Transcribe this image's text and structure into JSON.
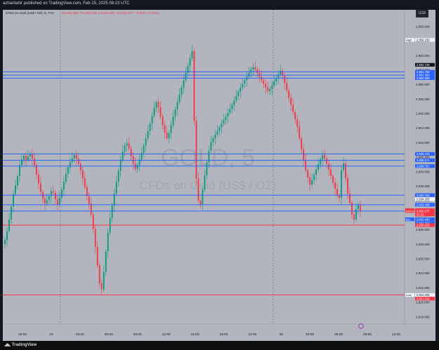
{
  "header": {
    "published": "azhantahir published on TradingView.com, Feb 25, 2025 08:23 UTC"
  },
  "legend": {
    "symbol": "CFDs on Gold (US$ / OZ), 5, TVC",
    "o": "O2,932.686",
    "h": "H2,933.868",
    "l": "L2,932.035",
    "c": "C2,932.577",
    "change": "−0.003 (−0.00%)"
  },
  "watermark": {
    "line1": "GOLD, 5",
    "line2": "CFDs on Gold (US$ / OZ)"
  },
  "currency_button": "USD",
  "footer": {
    "brand": "TradingView"
  },
  "colors": {
    "background": "#b2b5be",
    "up_candle": "#089981",
    "down_candle": "#f23645",
    "blue_line": "#2962ff",
    "red_line": "#f23645"
  },
  "chart_data": {
    "type": "candlestick",
    "title": "CFDs on Gold (US$ / OZ), 5, TVC",
    "ylim": [
      2917.0,
      2960.3
    ],
    "y_ticks": [
      2958,
      2956,
      2954,
      2952,
      2950,
      2948,
      2946,
      2944,
      2942,
      2940,
      2938,
      2936,
      2934,
      2932,
      2930,
      2928,
      2926,
      2924,
      2922,
      2920,
      2918
    ],
    "y_tick_labels": [
      "2,958.000",
      "2,956.000",
      "2,954.000",
      "2,952.000",
      "2,950.000",
      "2,948.000",
      "2,946.000",
      "2,944.000",
      "2,942.000",
      "2,940.000",
      "2,938.000",
      "2,936.000",
      "2,934.000",
      "2,932.000",
      "2,930.000",
      "2,928.000",
      "2,926.000",
      "2,924.000",
      "2,922.000",
      "2,920.000",
      "2,918.000"
    ],
    "x_ticks": [
      "18:00",
      "23",
      "03:00",
      "06:00",
      "09:00",
      "12:00",
      "15:00",
      "18:00",
      "21:00",
      "25",
      "03:00",
      "06:00",
      "09:00",
      "12:00"
    ],
    "horizontal_levels": [
      {
        "price": 2951.76,
        "label": "2,951.760",
        "kind": "blue"
      },
      {
        "price": 2951.3,
        "label": "2,951.303",
        "kind": "blue"
      },
      {
        "price": 2950.889,
        "label": "2,950.889",
        "kind": "blue"
      },
      {
        "price": 2940.443,
        "label": "2,940.443",
        "kind": "blue"
      },
      {
        "price": 2939.571,
        "label": "2,939.571",
        "kind": "blue"
      },
      {
        "price": 2938.767,
        "label": "2,938.767",
        "kind": "blue"
      },
      {
        "price": 2934.764,
        "label": "2,934.764",
        "kind": "blue"
      },
      {
        "price": 2933.448,
        "label": "2,933.448",
        "kind": "blue"
      },
      {
        "price": 2932.577,
        "label": "2,932.577",
        "kind": "blue"
      },
      {
        "price": 2930.629,
        "label": "2,930.629",
        "kind": "red"
      },
      {
        "price": 2921.012,
        "label": "2,921.012",
        "kind": "red"
      }
    ],
    "price_labels": [
      {
        "price": 2956.15,
        "text": "2,956.150",
        "tag": "High",
        "style": "plain"
      },
      {
        "price": 2952.725,
        "text": "2,952.725",
        "tag": "",
        "style": "dark"
      },
      {
        "price": 2951.76,
        "text": "2,951.760",
        "tag": "",
        "style": "blue"
      },
      {
        "price": 2951.3,
        "text": "2,951.303",
        "tag": "",
        "style": "blue"
      },
      {
        "price": 2950.889,
        "text": "2,950.889",
        "tag": "",
        "style": "blue"
      },
      {
        "price": 2940.443,
        "text": "2,940.443",
        "tag": "",
        "style": "blue"
      },
      {
        "price": 2939.571,
        "text": "2,939.571",
        "tag": "",
        "style": "blue"
      },
      {
        "price": 2938.767,
        "text": "2,938.767",
        "tag": "",
        "style": "blue"
      },
      {
        "price": 2934.764,
        "text": "2,934.764",
        "tag": "",
        "style": "blue"
      },
      {
        "price": 2934.2,
        "text": "2,934.205",
        "tag": "",
        "style": "plain"
      },
      {
        "price": 2933.448,
        "text": "2,933.448",
        "tag": "",
        "style": "blue"
      },
      {
        "price": 2932.69,
        "text": "2,932.690",
        "tag": "Ask",
        "style": "red"
      },
      {
        "price": 2932.577,
        "text": "2,932.577",
        "tag": "GOLD",
        "style": "red"
      },
      {
        "price": 2932.1,
        "text": "01:32",
        "tag": "",
        "style": "red"
      },
      {
        "price": 2931.43,
        "text": "2,932.430",
        "tag": "Bid",
        "style": "blue"
      },
      {
        "price": 2930.9,
        "text": "2,932.297",
        "tag": "",
        "style": "blue"
      },
      {
        "price": 2930.629,
        "text": "2,930.629",
        "tag": "",
        "style": "red"
      },
      {
        "price": 2921.005,
        "text": "2,921.005",
        "tag": "Low",
        "style": "plain"
      },
      {
        "price": 2920.5,
        "text": "2,921.012",
        "tag": "",
        "style": "red"
      }
    ],
    "candles_close": [
      2928.6,
      2929.8,
      2931.4,
      2933.2,
      2934.9,
      2936.1,
      2937.4,
      2938.9,
      2939.7,
      2940.2,
      2939.6,
      2940.1,
      2940.5,
      2939.8,
      2938.9,
      2937.6,
      2936.4,
      2935.2,
      2934.3,
      2933.6,
      2934.1,
      2934.6,
      2935.3,
      2935.1,
      2934.2,
      2933.5,
      2934.4,
      2935.5,
      2936.6,
      2937.7,
      2938.6,
      2939.3,
      2939.8,
      2940.3,
      2939.8,
      2939.1,
      2938.2,
      2937.1,
      2935.9,
      2934.6,
      2933.6,
      2932.1,
      2930.1,
      2927.6,
      2925.1,
      2922.6,
      2921.8,
      2924.2,
      2927.0,
      2929.6,
      2931.6,
      2933.3,
      2935.0,
      2936.6,
      2938.1,
      2939.6,
      2940.8,
      2941.6,
      2941.9,
      2941.2,
      2940.1,
      2939.1,
      2938.4,
      2938.9,
      2939.7,
      2940.6,
      2941.6,
      2942.6,
      2943.6,
      2944.6,
      2945.7,
      2946.8,
      2947.6,
      2946.9,
      2945.6,
      2944.4,
      2943.4,
      2942.6,
      2943.3,
      2944.4,
      2945.6,
      2946.6,
      2947.6,
      2948.6,
      2949.6,
      2950.6,
      2951.6,
      2952.6,
      2953.6,
      2954.6,
      2945.0,
      2937.0,
      2934.0,
      2933.5,
      2935.5,
      2937.5,
      2939.3,
      2940.9,
      2942.1,
      2942.6,
      2943.1,
      2943.6,
      2944.1,
      2944.6,
      2945.1,
      2945.6,
      2946.1,
      2946.6,
      2947.2,
      2947.8,
      2948.4,
      2949.0,
      2949.6,
      2950.1,
      2950.6,
      2951.1,
      2951.6,
      2952.1,
      2952.4,
      2952.1,
      2951.6,
      2951.1,
      2950.6,
      2950.1,
      2949.6,
      2949.1,
      2949.4,
      2949.9,
      2950.4,
      2950.9,
      2951.4,
      2951.9,
      2951.2,
      2950.2,
      2949.2,
      2948.2,
      2947.2,
      2946.2,
      2945.2,
      2944.2,
      2942.6,
      2941.1,
      2939.6,
      2938.2,
      2937.2,
      2936.2,
      2936.9,
      2937.6,
      2938.3,
      2939.0,
      2939.7,
      2940.3,
      2939.8,
      2939.1,
      2938.3,
      2937.4,
      2936.5,
      2935.6,
      2934.7,
      2934.4,
      2938.2,
      2939.1,
      2937.1,
      2935.0,
      2933.7,
      2932.1,
      2931.4,
      2932.8,
      2933.4,
      2932.577
    ]
  }
}
